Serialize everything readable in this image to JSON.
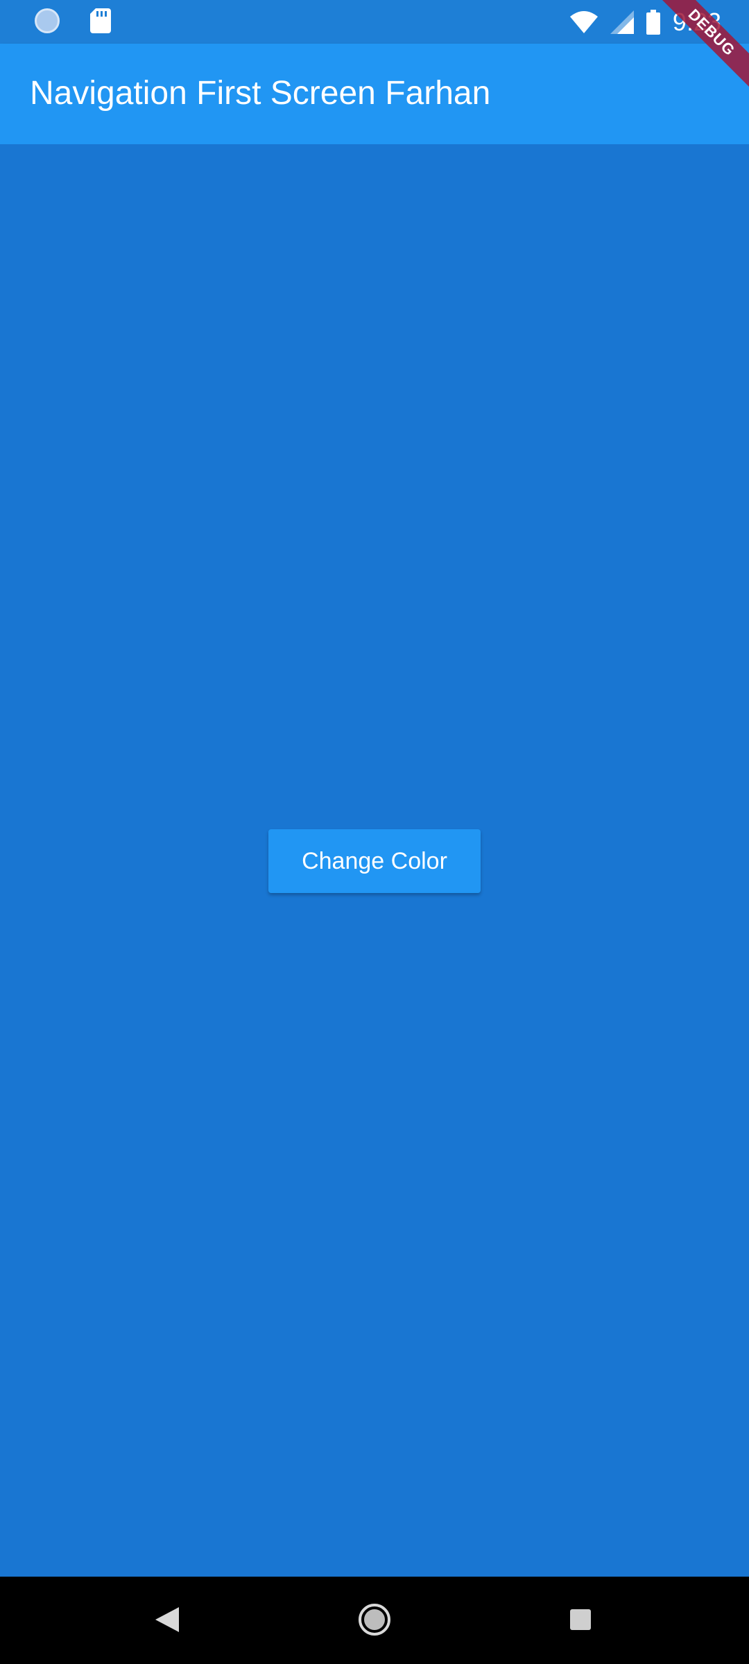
{
  "status_bar": {
    "time": "9:23",
    "icons": [
      "notification-dot-icon",
      "sd-card-icon",
      "wifi-icon",
      "signal-icon",
      "battery-icon"
    ]
  },
  "app_bar": {
    "title": "Navigation First Screen Farhan",
    "color": "#2196f3"
  },
  "debug_banner": {
    "label": "DEBUG"
  },
  "body": {
    "background": "#1976d2",
    "button_label": "Change Color"
  },
  "nav_bar": {
    "buttons": [
      "back-icon",
      "home-icon",
      "recents-icon"
    ]
  }
}
